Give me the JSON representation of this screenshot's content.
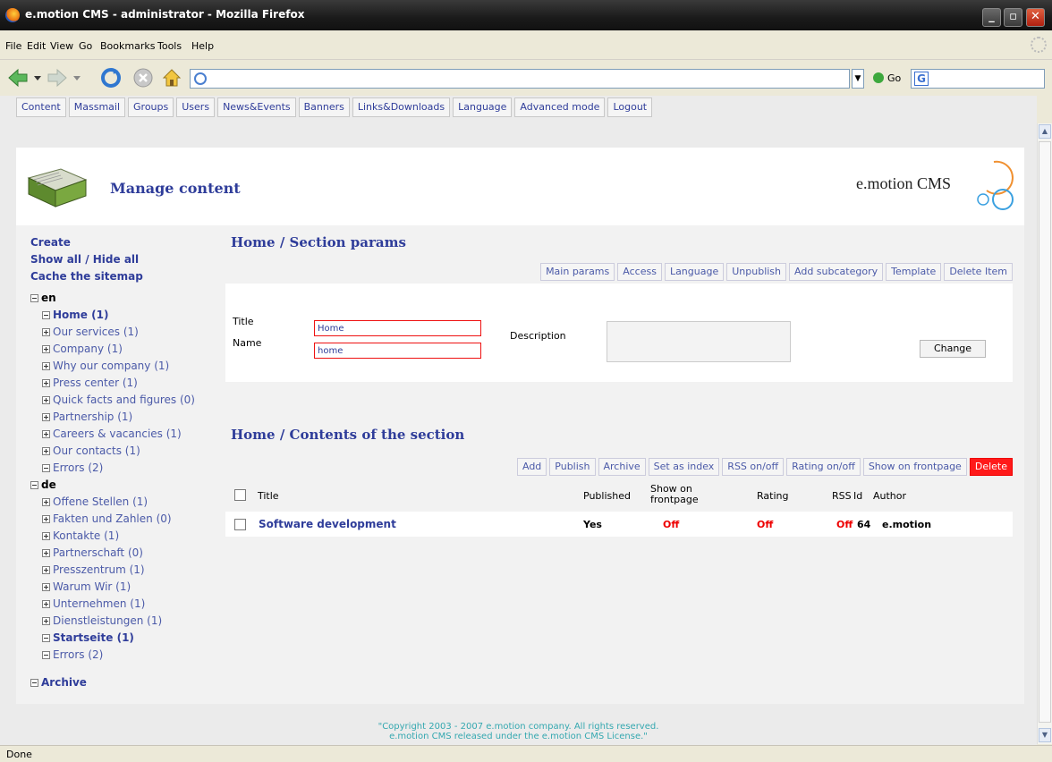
{
  "window": {
    "title": "e.motion CMS - administrator - Mozilla Firefox",
    "controls": {
      "minimize": "_",
      "maximize": "▫",
      "close": "✕"
    }
  },
  "menubar": [
    "File",
    "Edit",
    "View",
    "Go",
    "Bookmarks",
    "Tools",
    "Help"
  ],
  "navbar": {
    "url": "",
    "go_label": "Go",
    "search_engine_letter": "G"
  },
  "cms_menu": [
    "Content",
    "Massmail",
    "Groups",
    "Users",
    "News&Events",
    "Banners",
    "Links&Downloads",
    "Language",
    "Advanced mode",
    "Logout"
  ],
  "header": {
    "heading": "Manage content",
    "brand": "e.motion CMS"
  },
  "sidebar": {
    "actions": [
      "Create",
      "Show all / Hide all",
      "Cache the sitemap"
    ],
    "tree_en": {
      "label": "en",
      "items": [
        {
          "label": "Home (1)",
          "bold": true,
          "expanded": true
        },
        {
          "label": "Our services (1)"
        },
        {
          "label": "Company (1)"
        },
        {
          "label": "Why our company (1)"
        },
        {
          "label": "Press center (1)"
        },
        {
          "label": "Quick facts and figures (0)"
        },
        {
          "label": "Partnership (1)"
        },
        {
          "label": "Careers & vacancies (1)"
        },
        {
          "label": "Our contacts (1)"
        },
        {
          "label": "Errors (2)",
          "expanded": true
        }
      ]
    },
    "tree_de": {
      "label": "de",
      "items": [
        {
          "label": "Offene Stellen (1)"
        },
        {
          "label": "Fakten und Zahlen (0)"
        },
        {
          "label": "Kontakte (1)"
        },
        {
          "label": "Partnerschaft (0)"
        },
        {
          "label": "Presszentrum (1)"
        },
        {
          "label": "Warum Wir (1)"
        },
        {
          "label": "Unternehmen (1)"
        },
        {
          "label": "Dienstleistungen (1)"
        },
        {
          "label": "Startseite (1)",
          "bold": true,
          "expanded": true
        },
        {
          "label": "Errors (2)",
          "expanded": true
        }
      ]
    },
    "archive": "Archive"
  },
  "section_params": {
    "title": "Home / Section params",
    "tabs": [
      "Main params",
      "Access",
      "Language",
      "Unpublish",
      "Add subcategory",
      "Template",
      "Delete Item"
    ],
    "labels": {
      "title": "Title",
      "name": "Name",
      "description": "Description"
    },
    "values": {
      "title": "Home",
      "name": "home"
    },
    "change_button": "Change"
  },
  "contents": {
    "title": "Home / Contents of the section",
    "tabs": [
      "Add",
      "Publish",
      "Archive",
      "Set as index",
      "RSS on/off",
      "Rating on/off",
      "Show on frontpage"
    ],
    "delete_tab": "Delete",
    "columns": {
      "title": "Title",
      "published": "Published",
      "frontpage_l1": "Show on",
      "frontpage_l2": "frontpage",
      "rating": "Rating",
      "rss": "RSS",
      "id": "Id",
      "author": "Author"
    },
    "rows": [
      {
        "title": "Software development",
        "published": "Yes",
        "frontpage": "Off",
        "rating": "Off",
        "rss": "Off",
        "id": "64",
        "author": "e.motion"
      }
    ]
  },
  "footer": {
    "line1": "\"Copyright 2003 - 2007 e.motion company. All rights reserved.",
    "line2": "e.motion CMS released under the e.motion CMS License.\""
  },
  "statusbar": {
    "text": "Done"
  }
}
